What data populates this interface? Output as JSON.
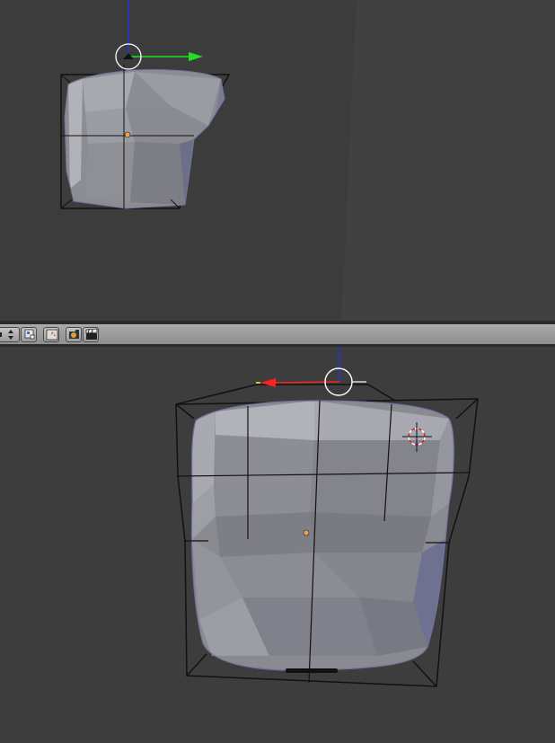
{
  "app": {
    "name": "3D View",
    "colors": {
      "viewport_bg": "#3d3d3d",
      "mesh_fill": "#8e8e92",
      "mesh_highlight": "#b6b8c4",
      "mesh_edge": "#6b6f90",
      "axis_x": "#ff2020",
      "axis_y": "#20e020",
      "axis_z": "#2030ff",
      "origin": "#f0a050",
      "header_bg": "#9b9b9b"
    }
  },
  "viewports": {
    "top": {
      "label": "top-viewport",
      "gizmo_axes": [
        "z-axis",
        "y-axis"
      ]
    },
    "bottom": {
      "label": "bottom-viewport",
      "gizmo_axes": [
        "z-axis",
        "x-axis"
      ]
    }
  },
  "header": {
    "buttons": [
      {
        "name": "layer-stepper",
        "icon": "stepper-icon"
      },
      {
        "name": "layer-grid-button",
        "icon": "layers-icon"
      },
      {
        "name": "lock-camera-button",
        "icon": "arrow-icon"
      },
      {
        "name": "render-camera-button",
        "icon": "camera-icon"
      },
      {
        "name": "render-anim-button",
        "icon": "clapper-icon"
      }
    ]
  }
}
